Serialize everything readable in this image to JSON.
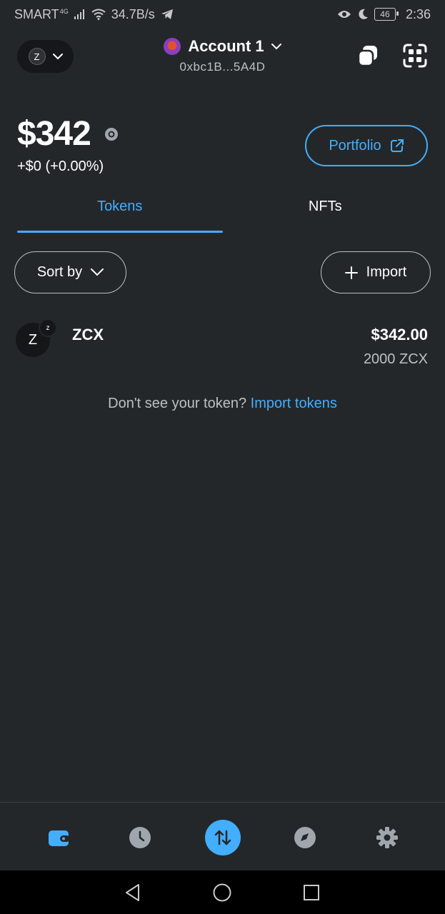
{
  "status_bar": {
    "carrier": "SMART",
    "network_type": "4G",
    "speed": "34.7B/s",
    "battery": "46",
    "time": "2:36",
    "icons": [
      "signal-icon",
      "wifi-icon",
      "telegram-icon",
      "eye-icon",
      "moon-icon",
      "battery-icon"
    ]
  },
  "header": {
    "network_initial": "Z",
    "account_name": "Account 1",
    "account_address": "0xbc1B...5A4D"
  },
  "balance": {
    "value": "$342",
    "change": "+$0 (+0.00%)",
    "portfolio_label": "Portfolio"
  },
  "tabs": [
    {
      "label": "Tokens",
      "active": true
    },
    {
      "label": "NFTs",
      "active": false
    }
  ],
  "controls": {
    "sort_label": "Sort by",
    "import_label": "Import"
  },
  "tokens": [
    {
      "icon_letter": "Z",
      "badge_letter": "z",
      "name": "ZCX",
      "fiat_value": "$342.00",
      "amount": "2000 ZCX"
    }
  ],
  "hint": {
    "text": "Don't see your token?",
    "link": "Import tokens"
  },
  "bottom_nav": {
    "items": [
      "wallet-icon",
      "activity-clock-icon",
      "swap-icon",
      "browser-compass-icon",
      "settings-gear-icon"
    ],
    "active": "wallet-icon"
  },
  "colors": {
    "background": "#24272a",
    "accent": "#43aefc",
    "muted_text": "#bbc0c5",
    "inactive_icon": "#9fa6ae"
  }
}
